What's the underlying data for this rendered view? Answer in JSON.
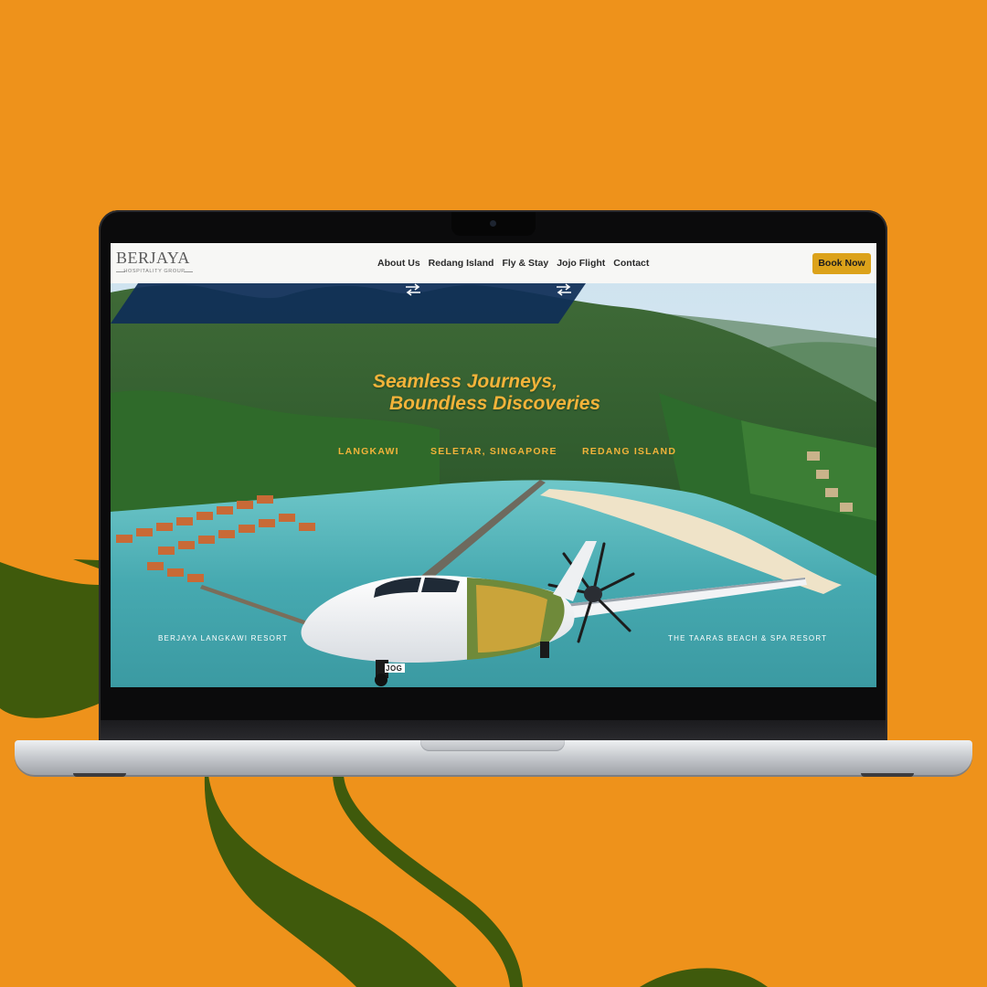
{
  "brand": {
    "name": "BERJAYA",
    "tagline": "HOSPITALITY GROUP"
  },
  "nav": {
    "items": [
      {
        "label": "About Us"
      },
      {
        "label": "Redang Island"
      },
      {
        "label": "Fly & Stay"
      },
      {
        "label": "Jojo Flight"
      },
      {
        "label": "Contact"
      }
    ],
    "cta_label": "Book Now"
  },
  "hero": {
    "headline_line1": "Seamless Journeys,",
    "headline_line2": "Boundless Discoveries",
    "route": {
      "stop1": "LANGKAWI",
      "stop2": "SELETAR, SINGAPORE",
      "stop3": "REDANG ISLAND",
      "connector_icon": "swap-arrows-icon"
    },
    "label_left": "BERJAYA LANGKAWI RESORT",
    "label_right": "THE TAARAS BEACH & SPA RESORT",
    "aircraft_registration": "JOG"
  },
  "colors": {
    "page_background": "#EE921B",
    "decor_green": "#3F5A0C",
    "accent_gold": "#F2B33A",
    "button_gold": "#DCA21A",
    "banner_navy": "#0F2E57"
  }
}
